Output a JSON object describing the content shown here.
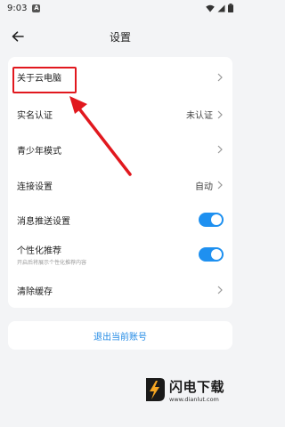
{
  "status_bar": {
    "time": "9:03",
    "notification_letter": "A",
    "icons": [
      "wifi-icon",
      "signal-icon",
      "battery-icon"
    ]
  },
  "header": {
    "title": "设置",
    "back_icon": "arrow-left-icon"
  },
  "settings": {
    "about": {
      "label": "关于云电脑"
    },
    "realname": {
      "label": "实名认证",
      "value": "未认证"
    },
    "teen_mode": {
      "label": "青少年模式"
    },
    "connection": {
      "label": "连接设置",
      "value": "自动"
    },
    "push": {
      "label": "消息推送设置",
      "enabled": true
    },
    "personalization": {
      "label": "个性化推荐",
      "sublabel": "开启后将展示个性化推荐内容",
      "enabled": true
    },
    "clear_cache": {
      "label": "清除缓存"
    }
  },
  "logout": {
    "label": "退出当前账号"
  },
  "watermark": {
    "title": "闪电下载",
    "url": "www.dianlut.com"
  },
  "colors": {
    "accent": "#1e90f0",
    "highlight": "#e1181e",
    "background": "#f3f4f6"
  }
}
